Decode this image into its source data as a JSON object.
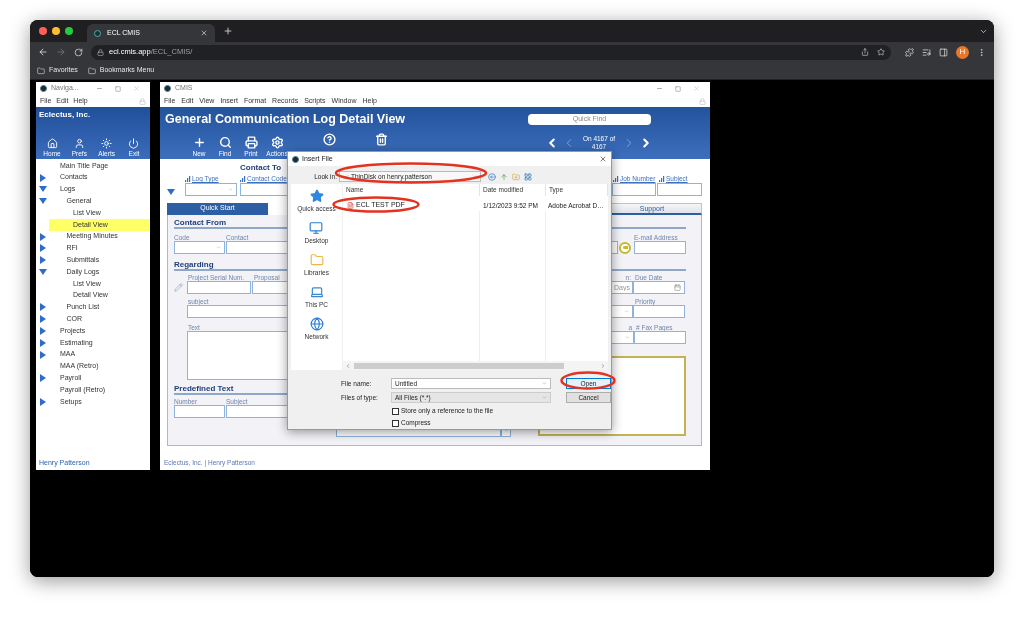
{
  "browser": {
    "tab_title": "ECL CMIS",
    "url_host": "ecl.cmis.app",
    "url_path": "/ECL_CMIS/",
    "bookmarks": [
      "Favorites",
      "Bookmarks Menu"
    ],
    "profile_initial": "H"
  },
  "nav_window": {
    "title": "Naviga...",
    "menu": [
      "File",
      "Edit",
      "Help"
    ],
    "company": "Eclectus, Inc.",
    "buttons": [
      "Home",
      "Prefs",
      "Alerts",
      "Exit"
    ],
    "tree": [
      {
        "label": "Main Title Page",
        "selected": false
      },
      {
        "label": "Contacts",
        "expanded": false,
        "selected": false
      },
      {
        "label": "Logs",
        "expanded": true,
        "selected": false,
        "children": [
          {
            "label": "General",
            "expanded": true,
            "selected": false,
            "children": [
              {
                "label": "List View",
                "selected": false
              },
              {
                "label": "Detail View",
                "selected": true
              }
            ]
          },
          {
            "label": "Meeting Minutes",
            "expanded": false,
            "selected": false
          },
          {
            "label": "RFI",
            "expanded": false,
            "selected": false
          },
          {
            "label": "Submittals",
            "expanded": false,
            "selected": false
          },
          {
            "label": "Daily Logs",
            "expanded": true,
            "selected": false,
            "children": [
              {
                "label": "List View",
                "selected": false
              },
              {
                "label": "Detail View",
                "selected": false
              }
            ]
          },
          {
            "label": "Punch List",
            "expanded": false,
            "selected": false
          },
          {
            "label": "COR",
            "expanded": false,
            "selected": false
          }
        ]
      },
      {
        "label": "Projects",
        "expanded": false,
        "selected": false
      },
      {
        "label": "Estimating",
        "expanded": false,
        "selected": false
      },
      {
        "label": "MAA",
        "expanded": false,
        "selected": false
      },
      {
        "label": "MAA (Retro)",
        "selected": false
      },
      {
        "label": "Payroll",
        "expanded": false,
        "selected": false
      },
      {
        "label": "Payroll (Retro)",
        "selected": false
      },
      {
        "label": "Setups",
        "expanded": false,
        "selected": false
      }
    ],
    "footer": "Henry Patterson"
  },
  "cmis_window": {
    "title": "CMIS",
    "menu": [
      "File",
      "Edit",
      "View",
      "Insert",
      "Format",
      "Records",
      "Scripts",
      "Window",
      "Help"
    ],
    "heading": "General Communication Log Detail View",
    "quick_find": {
      "placeholder": "Quick Find"
    },
    "toolbar": [
      {
        "kind": "new",
        "label": "New"
      },
      {
        "kind": "find",
        "label": "Find"
      },
      {
        "kind": "print",
        "label": "Print"
      },
      {
        "kind": "actions",
        "label": "Actions"
      },
      {
        "kind": "help"
      },
      {
        "kind": "delete"
      }
    ],
    "record": "On 4167 of 4167",
    "form": {
      "heading": "Contact To",
      "top_fields": [
        "Log Type",
        "Contact Code",
        "Job Number",
        "Subject"
      ],
      "tabs": [
        {
          "label": "Quick Start",
          "selected": true
        },
        {
          "label": "Support",
          "selected": false
        }
      ],
      "contact_from": {
        "heading": "Contact From",
        "code": "Code",
        "contact": "Contact",
        "email": "E-mail Address"
      },
      "regarding": {
        "heading": "Regarding",
        "project_serial": "Project Serial Num.",
        "proposal": "Proposal",
        "subject": "subject",
        "text": "Text",
        "due_label_fragment": "n:",
        "due_date": "Due Date",
        "days": {
          "placeholder": "Days"
        },
        "priority": "Priority",
        "fax_label_fragment": "a",
        "fax_pages": "# Fax Pages"
      },
      "predefined_text": {
        "heading": "Predefined Text",
        "number": "Number",
        "subject": "Subject"
      }
    },
    "footer": "Eclectus, Inc. | Henry Patterson"
  },
  "dialog": {
    "title": "Insert File",
    "look_in": {
      "label": "Look in:",
      "value": "ThinDisk on henry.patterson"
    },
    "places": [
      "Quick access",
      "Desktop",
      "Libraries",
      "This PC",
      "Network"
    ],
    "columns": [
      "Name",
      "Date modified",
      "Type"
    ],
    "files": [
      {
        "name": "ECL TEST PDF",
        "date": "1/12/2023 9:52 PM",
        "type": "Adobe Acrobat D…"
      }
    ],
    "file_name": {
      "label": "File name:",
      "value": "Untitled"
    },
    "file_type": {
      "label": "Files of type:",
      "value": "All Files (*.*)"
    },
    "options": [
      {
        "label": "Store only a reference to the file",
        "checked": false
      },
      {
        "label": "Compress",
        "checked": false
      }
    ],
    "buttons": [
      {
        "label": "Open",
        "default": true
      },
      {
        "label": "Cancel",
        "default": false
      }
    ]
  }
}
